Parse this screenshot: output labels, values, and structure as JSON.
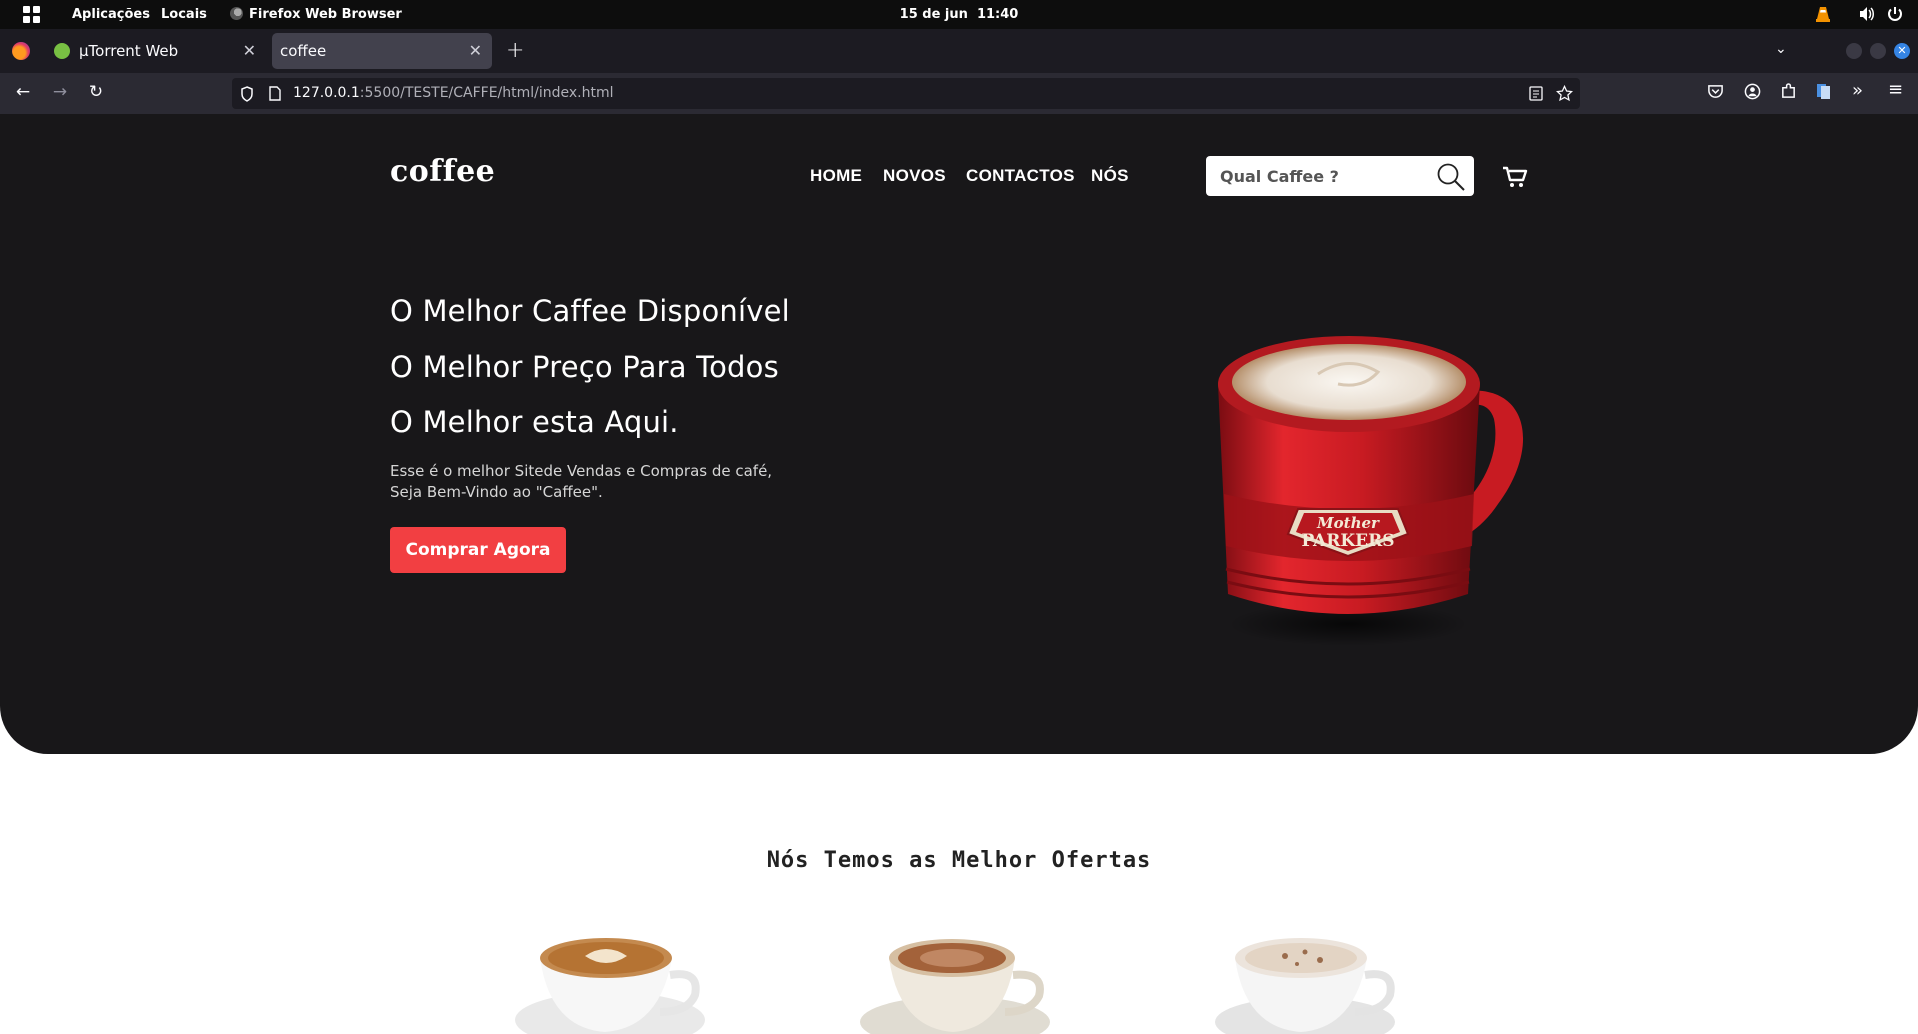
{
  "system_bar": {
    "applications": "Aplicações",
    "places": "Locais",
    "active_app": "Firefox Web Browser",
    "clock_date": "15 de jun",
    "clock_time": "11:40"
  },
  "browser": {
    "tabs": [
      {
        "label": "µTorrent Web",
        "active": false
      },
      {
        "label": "coffee",
        "active": true
      }
    ],
    "url_host": "127.0.0.1",
    "url_path": ":5500/TESTE/CAFFE/html/index.html"
  },
  "page": {
    "logo": "coffee",
    "nav": [
      "HOME",
      "NOVOS",
      "CONTACTOS",
      "NÓS"
    ],
    "search_placeholder": "Qual Caffee ?",
    "hero": {
      "line1": "O Melhor Caffee Disponível",
      "line2": "O Melhor Preço Para Todos",
      "line3": "O Melhor esta Aqui.",
      "description_line1": "Esse é o melhor Sitede Vendas e Compras de café,",
      "description_line2": "Seja Bem-Vindo ao \"Caffee\".",
      "cta": "Comprar Agora"
    },
    "mug_brand_line1": "Mother",
    "mug_brand_line2": "PARKERS",
    "offers_title": "Nós Temos as Melhor Ofertas"
  },
  "colors": {
    "hero_bg": "#181719",
    "cta": "#f23f42",
    "mug_red": "#d9222a"
  }
}
